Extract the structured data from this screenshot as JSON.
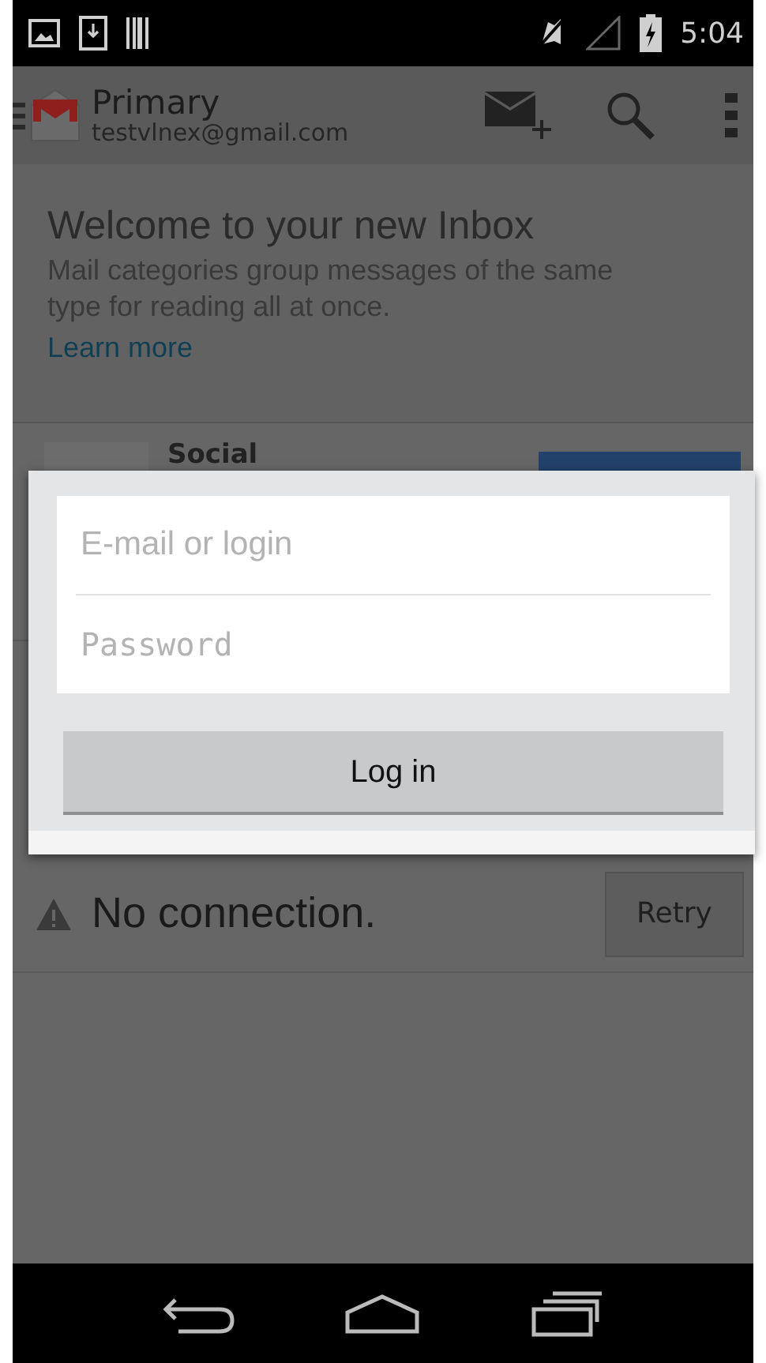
{
  "status_bar": {
    "time": "5:04"
  },
  "action_bar": {
    "title": "Primary",
    "account": "testvlnex@gmail.com"
  },
  "welcome": {
    "title": "Welcome to your new Inbox",
    "body": "Mail categories group messages of the same type for reading all at once.",
    "link": "Learn more"
  },
  "category_row": {
    "label": "Social"
  },
  "login_dialog": {
    "fields": [
      {
        "placeholder": "E-mail or login",
        "kind": "text"
      },
      {
        "placeholder": "Password",
        "kind": "password"
      }
    ],
    "button": "Log in"
  },
  "error_bar": {
    "message": "No connection.",
    "button": "Retry"
  }
}
